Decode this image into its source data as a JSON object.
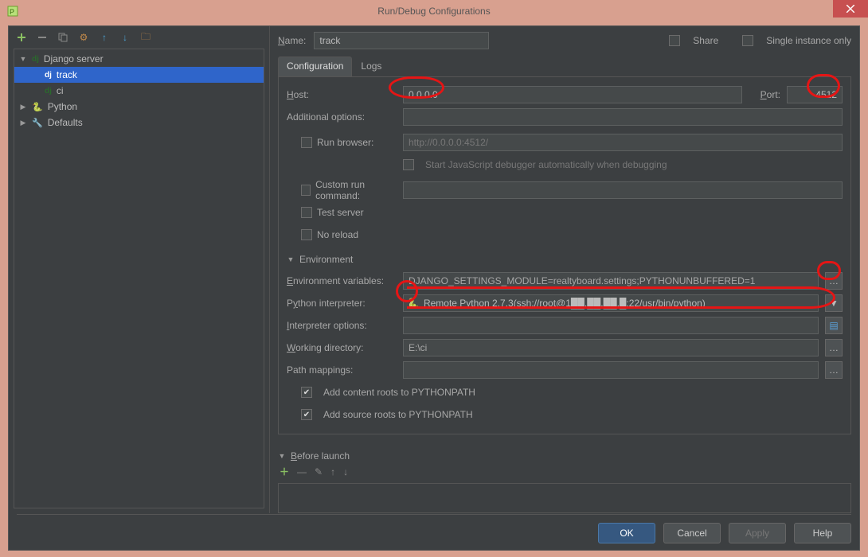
{
  "window": {
    "title": "Run/Debug Configurations"
  },
  "name_row": {
    "label": "Name:",
    "value": "track",
    "share_label": "Share",
    "single_instance_label": "Single instance only"
  },
  "tree": {
    "django_server": "Django server",
    "track": "track",
    "ci": "ci",
    "python": "Python",
    "defaults": "Defaults"
  },
  "tabs": {
    "configuration": "Configuration",
    "logs": "Logs"
  },
  "form": {
    "host_label": "Host:",
    "host_value": "0.0.0.0",
    "port_label": "Port:",
    "port_value": "4512",
    "additional_options_label": "Additional options:",
    "run_browser_label": "Run browser:",
    "run_browser_placeholder": "http://0.0.0.0:4512/",
    "start_js_label": "Start JavaScript debugger automatically when debugging",
    "custom_run_label": "Custom run command:",
    "test_server_label": "Test server",
    "no_reload_label": "No reload",
    "environment_section": "Environment",
    "env_vars_label": "Environment variables:",
    "env_vars_value": "DJANGO_SETTINGS_MODULE=realtyboard.settings;PYTHONUNBUFFERED=1",
    "interpreter_label": "Python interpreter:",
    "interpreter_value": "Remote Python 2.7.3(ssh://root@1██.██.██.█:22/usr/bin/python)",
    "interp_options_label": "Interpreter options:",
    "working_dir_label": "Working directory:",
    "working_dir_value": "E:\\ci",
    "path_mappings_label": "Path mappings:",
    "add_content_roots_label": "Add content roots to PYTHONPATH",
    "add_source_roots_label": "Add source roots to PYTHONPATH"
  },
  "before_launch": {
    "header": "Before launch"
  },
  "buttons": {
    "ok": "OK",
    "cancel": "Cancel",
    "apply": "Apply",
    "help": "Help"
  }
}
